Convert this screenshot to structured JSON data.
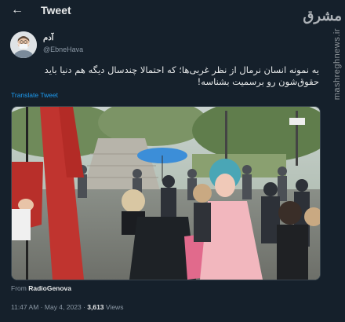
{
  "header": {
    "title": "Tweet"
  },
  "author": {
    "name": "آدم",
    "handle": "@EbneHava"
  },
  "tweet": {
    "text": "یه نمونه انسان نرمال از نظر غربی‌ها؛ که احتمالا چندسال دیگه هم دنیا باید حقوق‌شون رو برسمیت بشناسه!",
    "translate_label": "Translate Tweet",
    "source_prefix": "From",
    "source_name": "RadioGenova",
    "time": "11:47 AM",
    "separator": "·",
    "date": "May 4, 2023",
    "views_count": "3,613",
    "views_label": "Views"
  },
  "watermark": {
    "logo": "مشرق",
    "site": "mashreghnews.ir"
  }
}
